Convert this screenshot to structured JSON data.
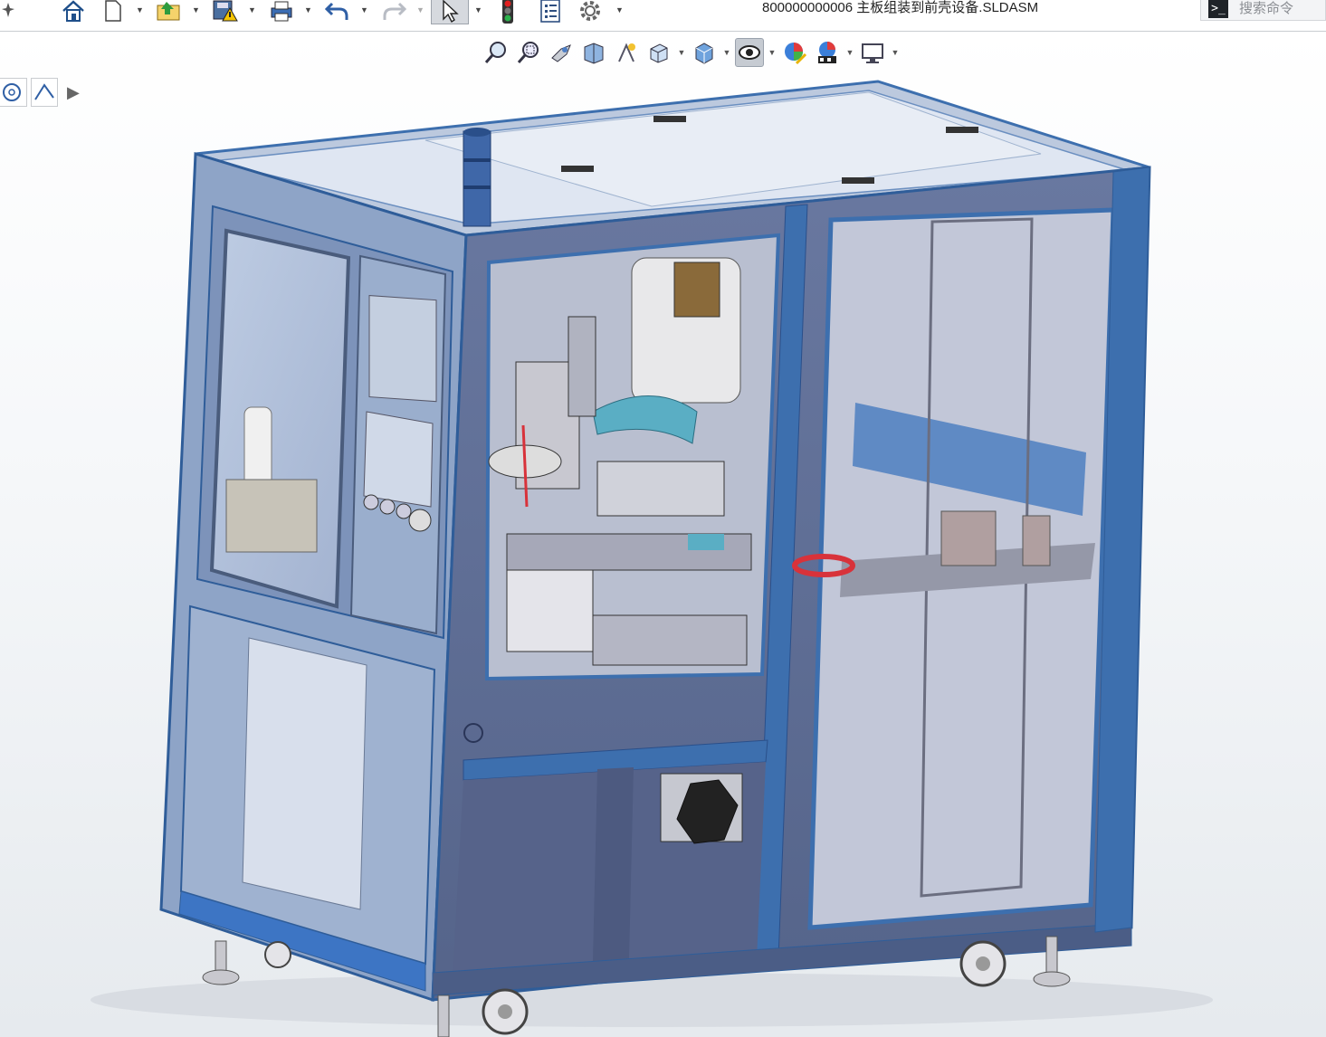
{
  "window": {
    "document_title": "800000000006 主板组装到前壳设备.SLDASM"
  },
  "toolbar": {
    "items": [
      {
        "name": "pin-icon"
      },
      {
        "name": "home-icon"
      },
      {
        "name": "new-document-icon"
      },
      {
        "name": "open-icon"
      },
      {
        "name": "save-warning-icon"
      },
      {
        "name": "print-icon"
      },
      {
        "name": "undo-icon"
      },
      {
        "name": "redo-icon"
      },
      {
        "name": "select-pointer-icon"
      },
      {
        "name": "rebuild-traffic-light-icon"
      },
      {
        "name": "file-properties-icon"
      },
      {
        "name": "options-gear-icon"
      }
    ]
  },
  "command_search": {
    "prompt_symbol": ">_",
    "placeholder": "搜索命令"
  },
  "heads_up_toolbar": {
    "items": [
      {
        "name": "zoom-to-fit-icon"
      },
      {
        "name": "zoom-to-area-icon"
      },
      {
        "name": "previous-view-icon"
      },
      {
        "name": "section-view-icon"
      },
      {
        "name": "dynamic-annotation-icon"
      },
      {
        "name": "view-orientation-icon"
      },
      {
        "name": "display-style-icon"
      },
      {
        "name": "hide-show-items-icon"
      },
      {
        "name": "edit-appearance-icon"
      },
      {
        "name": "apply-scene-icon"
      },
      {
        "name": "view-settings-icon"
      }
    ],
    "active": "hide-show-items-icon"
  },
  "mini_toolbar": {
    "items": [
      {
        "name": "circle-sketch-icon"
      },
      {
        "name": "line-sketch-icon"
      }
    ],
    "expand_symbol": "▶"
  },
  "colors": {
    "frame_blue": "#3d6fae",
    "frame_dark": "#2f5d99",
    "glass": "#9fb6d6",
    "panel_body": "#5f6f93",
    "interior": "#b8bccb",
    "accent_red": "#d8323a",
    "accent_cyan": "#5aaec4"
  }
}
